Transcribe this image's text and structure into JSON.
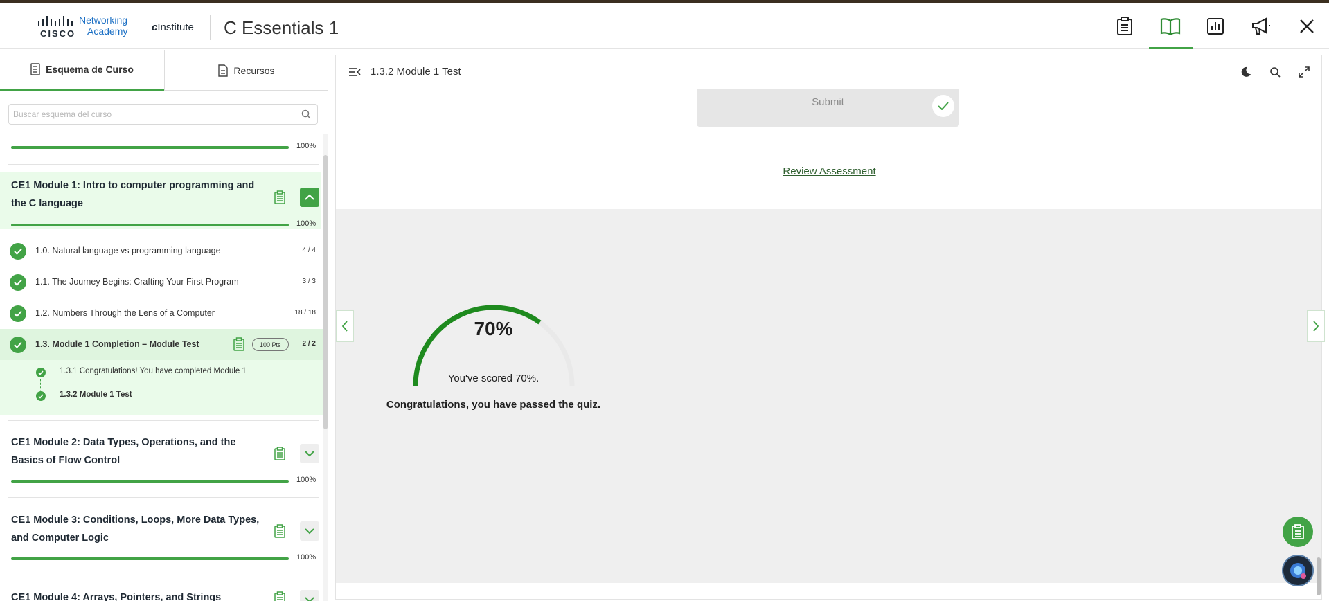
{
  "header": {
    "brand_word": "CISCO",
    "brand_line1": "Networking",
    "brand_line2": "Academy",
    "institute": "Institute",
    "course_title": "C Essentials 1",
    "icons": [
      "clipboard-icon",
      "book-icon",
      "chart-icon",
      "megaphone-icon",
      "close-icon"
    ],
    "active_icon": "book-icon",
    "accent_color": "#42a346"
  },
  "sidebar": {
    "tabs": [
      {
        "label": "Esquema de Curso",
        "active": true
      },
      {
        "label": "Recursos",
        "active": false
      }
    ],
    "search": {
      "placeholder": "Buscar esquema del curso",
      "value": ""
    },
    "top_progress": {
      "percent": 100,
      "label": "100%"
    },
    "modules": [
      {
        "title": "CE1 Module 1: Intro to computer programming and the C language",
        "progress": 100,
        "progress_label": "100%",
        "expanded": true,
        "lessons": [
          {
            "label": "1.0. Natural language vs programming language",
            "count": "4 / 4"
          },
          {
            "label": "1.1. The Journey Begins: Crafting Your First Program",
            "count": "3 / 3"
          },
          {
            "label": "1.2. Numbers Through the Lens of a Computer",
            "count": "18 / 18"
          },
          {
            "label": "1.3. Module 1 Completion – Module Test",
            "count": "2 / 2",
            "points": "100 Pts",
            "active": true
          }
        ],
        "subitems": [
          {
            "label": "1.3.1 Congratulations! You have completed Module 1"
          },
          {
            "label": "1.3.2 Module 1 Test",
            "current": true
          }
        ]
      },
      {
        "title": "CE1 Module 2: Data Types, Operations, and the Basics of Flow Control",
        "progress": 100,
        "progress_label": "100%",
        "expanded": false
      },
      {
        "title": "CE1 Module 3: Conditions, Loops, More Data Types, and Computer Logic",
        "progress": 100,
        "progress_label": "100%",
        "expanded": false
      },
      {
        "title": "CE1 Module 4: Arrays, Pointers, and Strings",
        "expanded": false
      }
    ]
  },
  "main": {
    "page_title": "1.3.2 Module 1 Test",
    "submit_label": "Submit",
    "review_label": "Review Assessment",
    "score_value": 70,
    "score_display": "70%",
    "score_sentence": "You've scored 70%.",
    "pass_message": "Congratulations, you have passed the quiz.",
    "gauge_color": "#1e8a1e"
  }
}
